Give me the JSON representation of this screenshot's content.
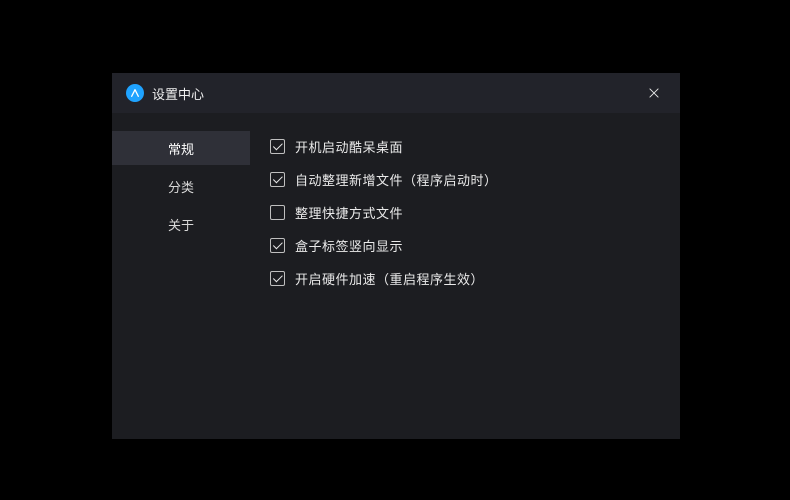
{
  "window": {
    "title": "设置中心"
  },
  "sidebar": {
    "items": [
      {
        "label": "常规",
        "active": true
      },
      {
        "label": "分类",
        "active": false
      },
      {
        "label": "关于",
        "active": false
      }
    ]
  },
  "settings": {
    "rows": [
      {
        "label": "开机启动酷呆桌面",
        "suffix": "",
        "checked": true
      },
      {
        "label": "自动整理新增文件",
        "suffix": "（程序启动时）",
        "checked": true
      },
      {
        "label": "整理快捷方式文件",
        "suffix": "",
        "checked": false
      },
      {
        "label": "盒子标签竖向显示",
        "suffix": "",
        "checked": true
      },
      {
        "label": "开启硬件加速",
        "suffix": "（重启程序生效）",
        "checked": true
      }
    ]
  }
}
